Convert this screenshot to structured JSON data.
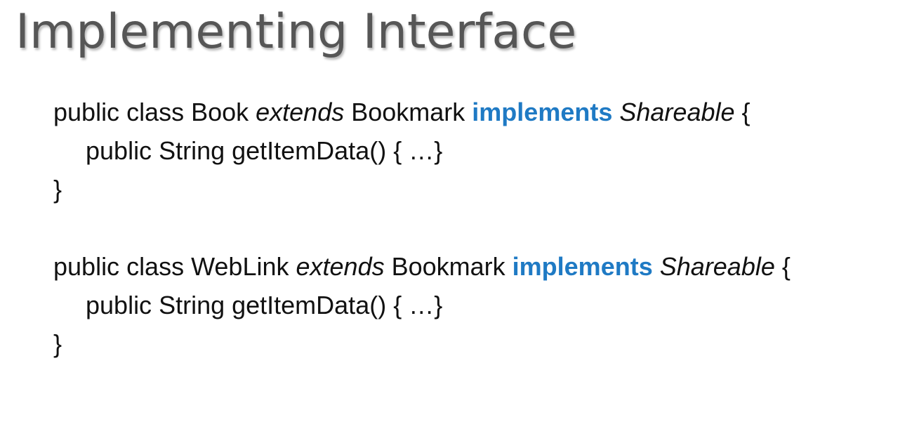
{
  "slide": {
    "title": "Implementing Interface",
    "accent_color": "#1f7ac4",
    "code_blocks": [
      {
        "line1": {
          "prefix": "public class Book ",
          "extends_kw": "extends",
          "mid": " Bookmark ",
          "implements_kw": "implements",
          "space": " ",
          "interface_name": "Shareable",
          "suffix": " {"
        },
        "line2": "public String getItemData() { …}",
        "line3": "}"
      },
      {
        "line1": {
          "prefix": "public class WebLink ",
          "extends_kw": "extends",
          "mid": " Bookmark ",
          "implements_kw": "implements",
          "space": " ",
          "interface_name": "Shareable",
          "suffix": " {"
        },
        "line2": "public String getItemData() { …}",
        "line3": "}"
      }
    ]
  }
}
